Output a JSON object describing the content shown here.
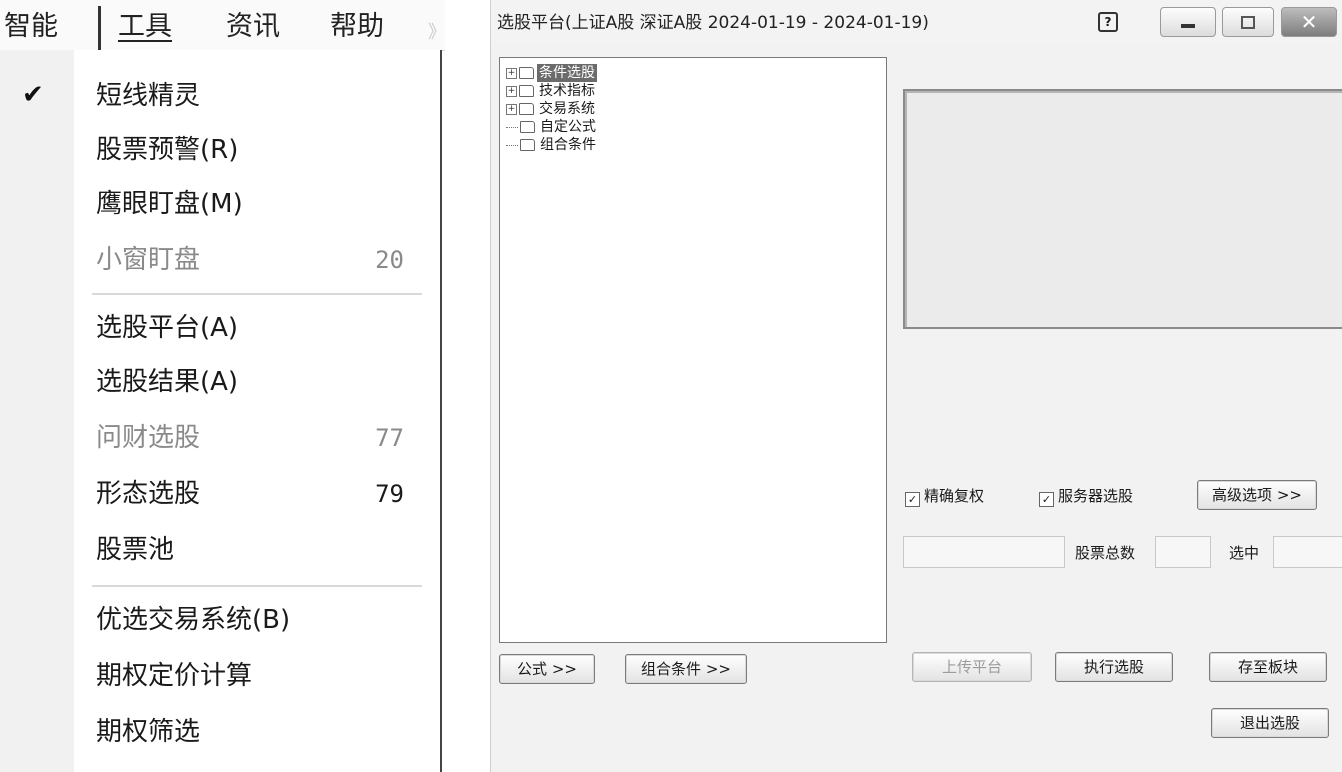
{
  "menubar": {
    "items": [
      "智能",
      "工具",
      "资讯",
      "帮助"
    ],
    "cut_item": "》"
  },
  "menu": {
    "items": [
      {
        "label": "短线精灵",
        "shortcut": "",
        "checked": true,
        "disabled": false
      },
      {
        "label": "股票预警(R)",
        "shortcut": "",
        "checked": false,
        "disabled": false
      },
      {
        "label": "鹰眼盯盘(M)",
        "shortcut": "",
        "checked": false,
        "disabled": false
      },
      {
        "label": "小窗盯盘",
        "shortcut": "20",
        "checked": false,
        "disabled": true
      },
      {
        "label": "选股平台(A)",
        "shortcut": "",
        "checked": false,
        "disabled": false
      },
      {
        "label": "选股结果(A)",
        "shortcut": "",
        "checked": false,
        "disabled": false
      },
      {
        "label": "问财选股",
        "shortcut": "77",
        "checked": false,
        "disabled": true
      },
      {
        "label": "形态选股",
        "shortcut": "79",
        "checked": false,
        "disabled": false
      },
      {
        "label": "股票池",
        "shortcut": "",
        "checked": false,
        "disabled": false
      },
      {
        "label": "优选交易系统(B)",
        "shortcut": "",
        "checked": false,
        "disabled": false
      },
      {
        "label": "期权定价计算",
        "shortcut": "",
        "checked": false,
        "disabled": false
      },
      {
        "label": "期权筛选",
        "shortcut": "",
        "checked": false,
        "disabled": false
      }
    ],
    "check_glyph": "✔"
  },
  "dialog": {
    "title": "选股平台(上证A股 深证A股   2024-01-19 - 2024-01-19)",
    "help_glyph": "?",
    "close_glyph": "✕",
    "tree": [
      {
        "label": "条件选股",
        "expand": "+",
        "selected": true
      },
      {
        "label": "技术指标",
        "expand": "+",
        "selected": false
      },
      {
        "label": "交易系统",
        "expand": "+",
        "selected": false
      },
      {
        "label": "自定公式",
        "expand": "",
        "selected": false
      },
      {
        "label": "组合条件",
        "expand": "",
        "selected": false
      }
    ],
    "checkboxes": [
      {
        "label": "精确复权",
        "checked": true
      },
      {
        "label": "服务器选股",
        "checked": true
      }
    ],
    "checkmark_glyph": "✓",
    "advanced_button": "高级选项 >>",
    "total_label": "股票总数",
    "selected_label": "选中",
    "formula_button": "公式 >>",
    "combo_button": "组合条件 >>",
    "upload_button": "上传平台",
    "run_button": "执行选股",
    "save_button": "存至板块",
    "exit_button": "退出选股"
  }
}
